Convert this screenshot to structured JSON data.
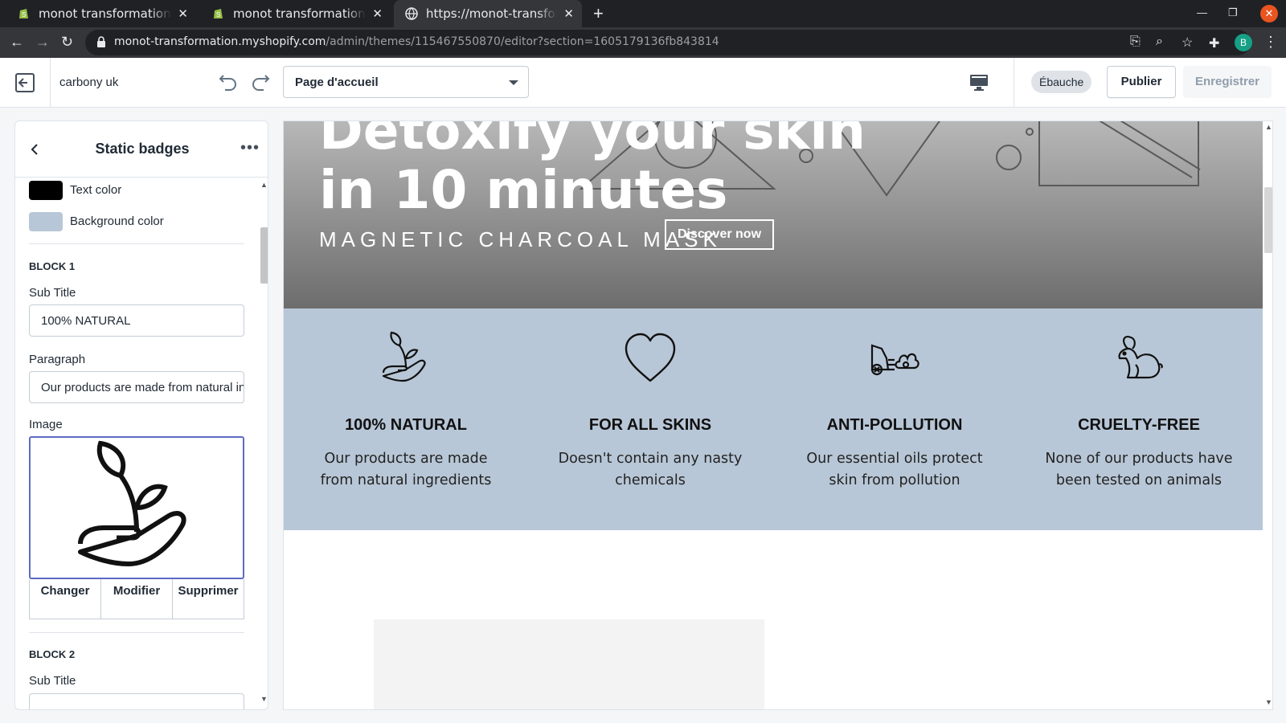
{
  "browser": {
    "tabs": [
      {
        "title": "monot transformation ~ T",
        "close": "✕"
      },
      {
        "title": "monot transformation ~ P",
        "close": "✕"
      },
      {
        "title": "https://monot-transform",
        "close": "✕"
      }
    ],
    "new_tab": "+",
    "url_host": "monot-transformation.myshopify.com",
    "url_path": "/admin/themes/115467550870/editor?section=1605179136fb843814",
    "profile_initial": "B"
  },
  "editor": {
    "store_name": "carbony uk",
    "page_select": "Page d'accueil",
    "status_badge": "Ébauche",
    "publish_label": "Publier",
    "save_label": "Enregistrer"
  },
  "sidebar": {
    "title": "Static badges",
    "more": "•••",
    "text_color_label": "Text color",
    "text_color": "#000000",
    "bg_color_label": "Background color",
    "bg_color": "#b8c7d7",
    "block1": {
      "heading": "BLOCK 1",
      "subtitle_label": "Sub Title",
      "subtitle_value": "100% NATURAL",
      "paragraph_label": "Paragraph",
      "paragraph_value": "Our products are made from natural ingredients",
      "image_label": "Image",
      "image_icon": "plant-in-hand-icon",
      "change": "Changer",
      "modify": "Modifier",
      "delete": "Supprimer"
    },
    "block2": {
      "heading": "BLOCK 2",
      "subtitle_label": "Sub Title"
    }
  },
  "preview": {
    "hero": {
      "title_line1": "Detoxify your skin",
      "title_line2": "in 10 minutes",
      "subtitle": "MAGNETIC CHARCOAL MASK",
      "button": "Discover now"
    },
    "badges": [
      {
        "icon": "plant-in-hand-icon",
        "title": "100% NATURAL",
        "text": "Our products are made from natural ingredients"
      },
      {
        "icon": "heart-icon",
        "title": "FOR ALL SKINS",
        "text": "Doesn't contain any nasty chemicals"
      },
      {
        "icon": "car-pollution-icon",
        "title": "ANTI-POLLUTION",
        "text": "Our essential oils protect skin from pollution"
      },
      {
        "icon": "rabbit-icon",
        "title": "CRUELTY-FREE",
        "text": "None of our products have been tested on animals"
      }
    ]
  }
}
